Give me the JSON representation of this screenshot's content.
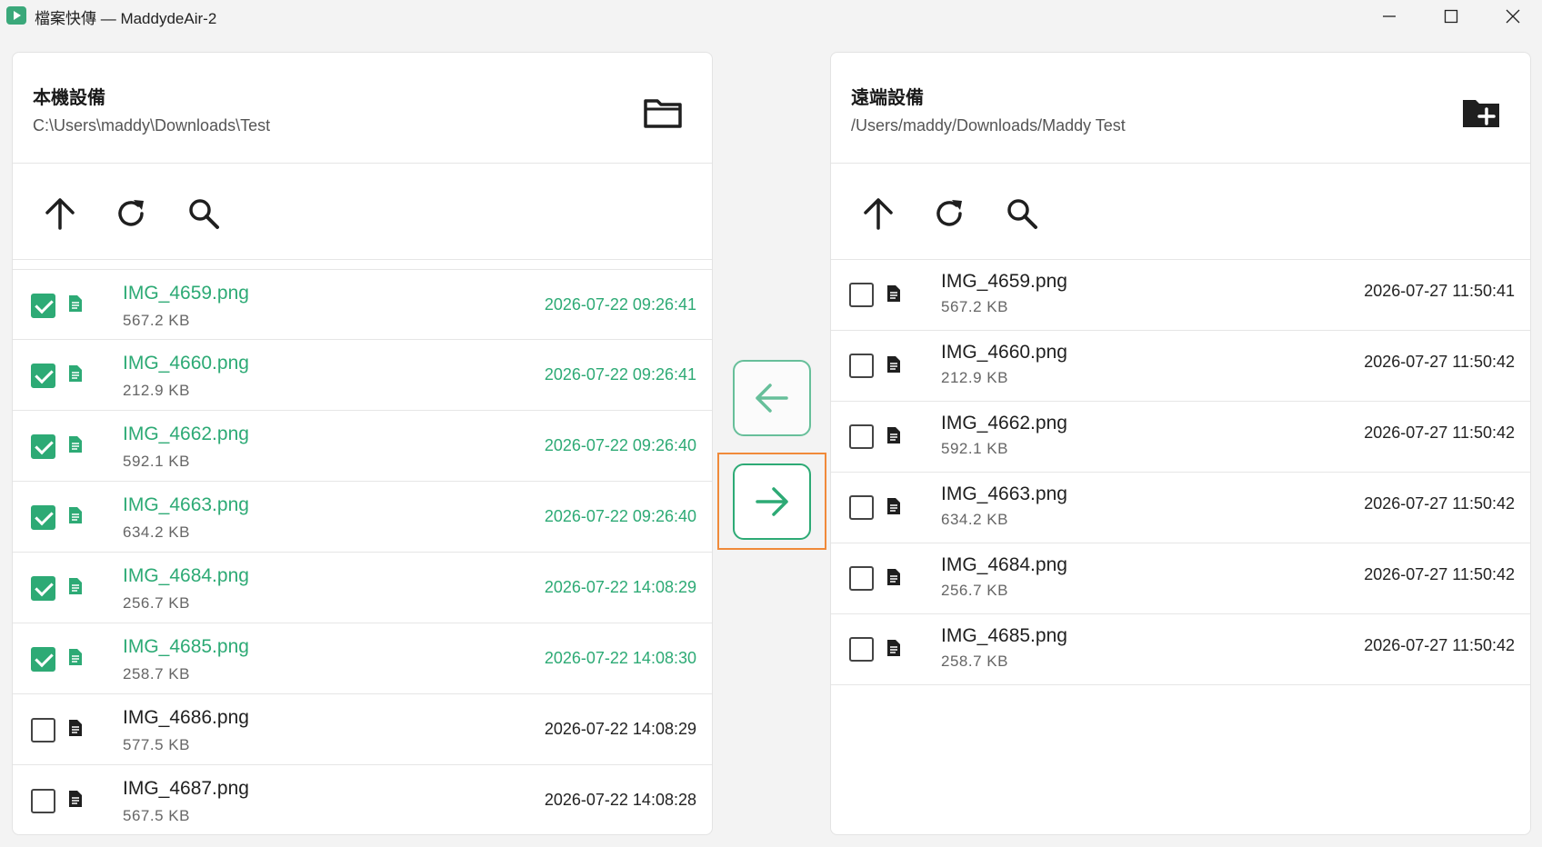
{
  "window": {
    "title": "檔案快傳 — MaddydeAir-2"
  },
  "local": {
    "title": "本機設備",
    "path": "C:\\Users\\maddy\\Downloads\\Test",
    "files": [
      {
        "name": "IMG_4659.png",
        "size": "567.2 KB",
        "date": "2026-07-22 09:26:41",
        "checked": true
      },
      {
        "name": "IMG_4660.png",
        "size": "212.9 KB",
        "date": "2026-07-22 09:26:41",
        "checked": true
      },
      {
        "name": "IMG_4662.png",
        "size": "592.1 KB",
        "date": "2026-07-22 09:26:40",
        "checked": true
      },
      {
        "name": "IMG_4663.png",
        "size": "634.2 KB",
        "date": "2026-07-22 09:26:40",
        "checked": true
      },
      {
        "name": "IMG_4684.png",
        "size": "256.7 KB",
        "date": "2026-07-22 14:08:29",
        "checked": true
      },
      {
        "name": "IMG_4685.png",
        "size": "258.7 KB",
        "date": "2026-07-22 14:08:30",
        "checked": true
      },
      {
        "name": "IMG_4686.png",
        "size": "577.5 KB",
        "date": "2026-07-22 14:08:29",
        "checked": false
      },
      {
        "name": "IMG_4687.png",
        "size": "567.5 KB",
        "date": "2026-07-22 14:08:28",
        "checked": false
      }
    ]
  },
  "remote": {
    "title": "遠端設備",
    "path": "/Users/maddy/Downloads/Maddy Test",
    "files": [
      {
        "name": "IMG_4659.png",
        "size": "567.2 KB",
        "date": "2026-07-27 11:50:41",
        "checked": false
      },
      {
        "name": "IMG_4660.png",
        "size": "212.9 KB",
        "date": "2026-07-27 11:50:42",
        "checked": false
      },
      {
        "name": "IMG_4662.png",
        "size": "592.1 KB",
        "date": "2026-07-27 11:50:42",
        "checked": false
      },
      {
        "name": "IMG_4663.png",
        "size": "634.2 KB",
        "date": "2026-07-27 11:50:42",
        "checked": false
      },
      {
        "name": "IMG_4684.png",
        "size": "256.7 KB",
        "date": "2026-07-27 11:50:42",
        "checked": false
      },
      {
        "name": "IMG_4685.png",
        "size": "258.7 KB",
        "date": "2026-07-27 11:50:42",
        "checked": false
      }
    ]
  },
  "colors": {
    "accent": "#2daa75",
    "highlight": "#f08a3a"
  },
  "icons": {
    "local_header": "folder-open-icon",
    "remote_header": "folder-plus-icon",
    "toolbar": [
      "arrow-up-icon",
      "refresh-icon",
      "search-icon"
    ],
    "transfer": [
      "arrow-left-icon",
      "arrow-right-icon"
    ]
  }
}
